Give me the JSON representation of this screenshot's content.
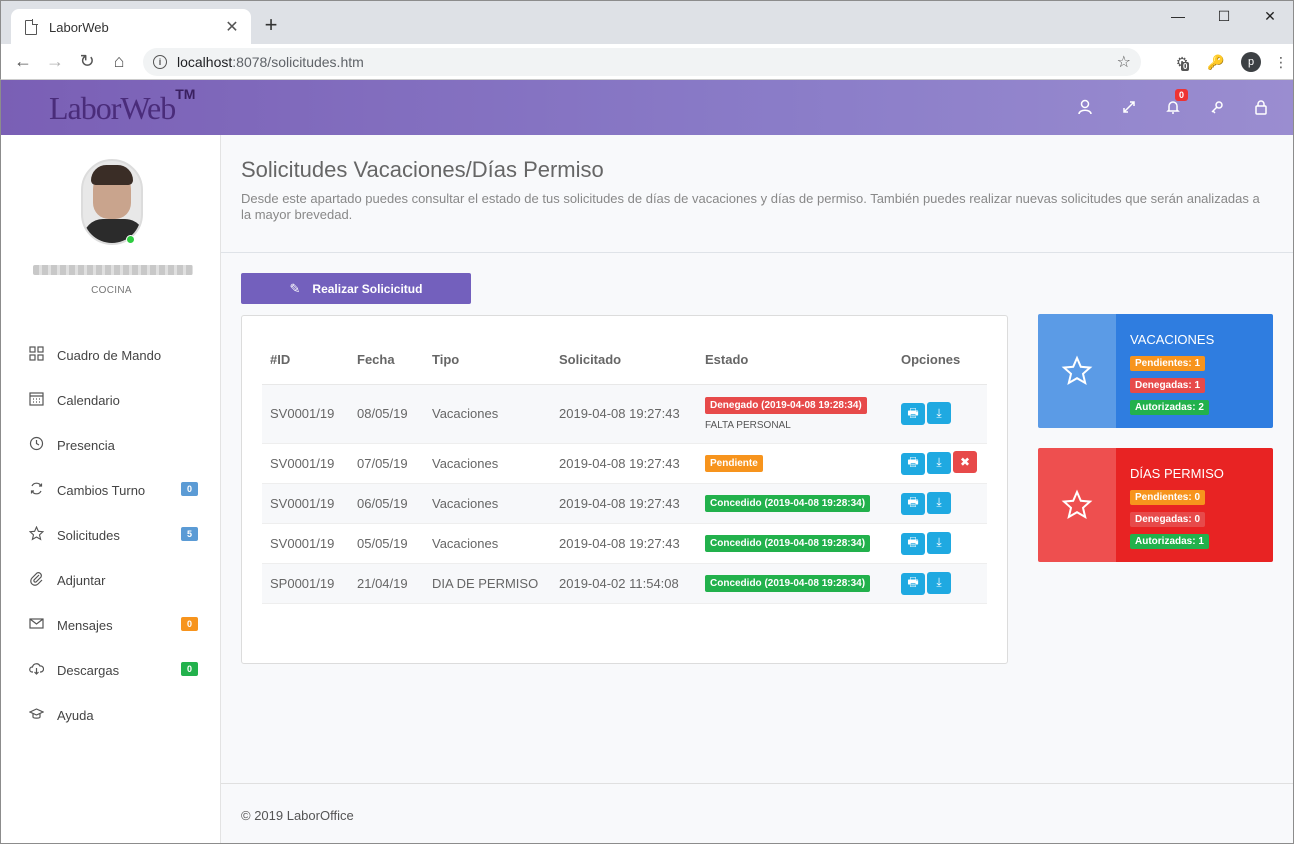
{
  "browser": {
    "tab_title": "LaborWeb",
    "url_host": "localhost",
    "url_rest": ":8078/solicitudes.htm",
    "ext_badge": "0",
    "profile_initial": "p"
  },
  "header": {
    "logo": "LaborWeb",
    "logo_tm": "TM",
    "notif_count": "0"
  },
  "user": {
    "department": "COCINA"
  },
  "sidebar": {
    "items": [
      {
        "label": "Cuadro de Mando",
        "icon": "grid-icon"
      },
      {
        "label": "Calendario",
        "icon": "calendar-icon"
      },
      {
        "label": "Presencia",
        "icon": "clock-icon"
      },
      {
        "label": "Cambios Turno",
        "icon": "refresh-icon",
        "badge": "0",
        "badge_color": "#5b9bd5"
      },
      {
        "label": "Solicitudes",
        "icon": "star-icon",
        "badge": "5",
        "badge_color": "#5b9bd5"
      },
      {
        "label": "Adjuntar",
        "icon": "paperclip-icon"
      },
      {
        "label": "Mensajes",
        "icon": "envelope-icon",
        "badge": "0",
        "badge_color": "#f7941d"
      },
      {
        "label": "Descargas",
        "icon": "cloud-download-icon",
        "badge": "0",
        "badge_color": "#22b14c"
      },
      {
        "label": "Ayuda",
        "icon": "graduation-cap-icon"
      }
    ]
  },
  "page": {
    "title": "Solicitudes Vacaciones/Días Permiso",
    "description": "Desde este apartado puedes consultar el estado de tus solicitudes de días de vacaciones y días de permiso. También puedes realizar nuevas solicitudes que serán analizadas a la mayor brevedad.",
    "request_button": "Realizar Solicicitud"
  },
  "table": {
    "headers": [
      "#ID",
      "Fecha",
      "Tipo",
      "Solicitado",
      "Estado",
      "Opciones"
    ],
    "rows": [
      {
        "id": "SV0001/19",
        "fecha": "08/05/19",
        "tipo": "Vacaciones",
        "solicitado": "2019-04-08 19:27:43",
        "estado": "Denegado (2019-04-08 19:28:34)",
        "estado_color": "#e74a4a",
        "nota": "FALTA PERSONAL",
        "deletable": false
      },
      {
        "id": "SV0001/19",
        "fecha": "07/05/19",
        "tipo": "Vacaciones",
        "solicitado": "2019-04-08 19:27:43",
        "estado": "Pendiente",
        "estado_color": "#f7941d",
        "nota": "",
        "deletable": true
      },
      {
        "id": "SV0001/19",
        "fecha": "06/05/19",
        "tipo": "Vacaciones",
        "solicitado": "2019-04-08 19:27:43",
        "estado": "Concedido (2019-04-08 19:28:34)",
        "estado_color": "#22b14c",
        "nota": "",
        "deletable": false
      },
      {
        "id": "SV0001/19",
        "fecha": "05/05/19",
        "tipo": "Vacaciones",
        "solicitado": "2019-04-08 19:27:43",
        "estado": "Concedido (2019-04-08 19:28:34)",
        "estado_color": "#22b14c",
        "nota": "",
        "deletable": false
      },
      {
        "id": "SP0001/19",
        "fecha": "21/04/19",
        "tipo": "DIA DE PERMISO",
        "solicitado": "2019-04-02 11:54:08",
        "estado": "Concedido (2019-04-08 19:28:34)",
        "estado_color": "#22b14c",
        "nota": "",
        "deletable": false
      }
    ]
  },
  "summaries": [
    {
      "title": "VACACIONES",
      "icon_bg": "#5b9be6",
      "text_bg": "#2f7de0",
      "pendientes": "Pendientes: 1",
      "denegadas": "Denegadas: 1",
      "autorizadas": "Autorizadas: 2"
    },
    {
      "title": "DÍAS PERMISO",
      "icon_bg": "#ee4f4f",
      "text_bg": "#e82323",
      "pendientes": "Pendientes: 0",
      "denegadas": "Denegadas: 0",
      "autorizadas": "Autorizadas: 1"
    }
  ],
  "footer": {
    "copyright": "© 2019 LaborOffice"
  }
}
